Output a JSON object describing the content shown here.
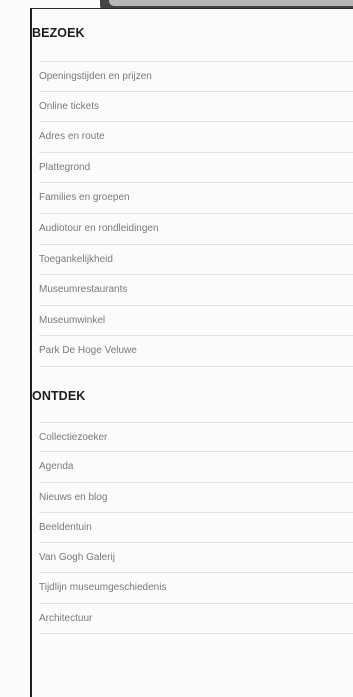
{
  "menu": {
    "sections": [
      {
        "heading": "BEZOEK",
        "items": [
          "Openingstijden en prijzen",
          "Online tickets",
          "Adres en route",
          "Plattegrond",
          "Families en groepen",
          "Audiotour en rondleidingen",
          "Toegankelijkheid",
          "Museumrestaurants",
          "Museumwinkel",
          "Park De Hoge Veluwe"
        ]
      },
      {
        "heading": "ONTDEK",
        "items": [
          "Collectiezoeker",
          "Agenda",
          "Nieuws en blog",
          "Beeldentuin",
          "Van Gogh Galerij",
          "Tijdlijn museumgeschiedenis",
          "Architectuur"
        ]
      }
    ]
  },
  "colors": {
    "background": "#fbfbfb",
    "heading_text": "#1d1d1d",
    "item_text": "#7a7a7a",
    "divider": "#e2e2e2",
    "panel_border": "#1e1e1e"
  }
}
